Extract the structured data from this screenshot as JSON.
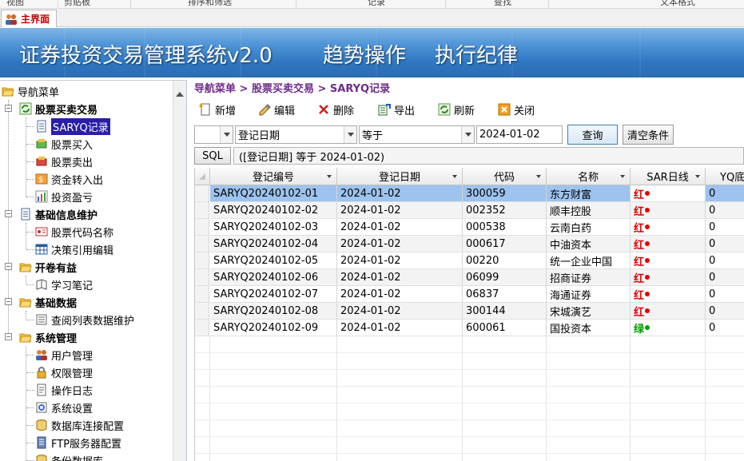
{
  "ribbon": {
    "groups": [
      "视图",
      "剪贴板",
      "排序和筛选",
      "记录",
      "查找",
      "文本格式"
    ]
  },
  "tab": {
    "label": "主界面"
  },
  "banner": {
    "title": "证券投资交易管理系统v2.0",
    "slogan1": "趋势操作",
    "slogan2": "执行纪律"
  },
  "nav": {
    "root": "导航菜单",
    "groups": [
      {
        "label": "股票买卖交易",
        "items": [
          "SARYQ记录",
          "股票买入",
          "股票卖出",
          "资金转入出",
          "投资盈亏"
        ]
      },
      {
        "label": "基础信息维护",
        "items": [
          "股票代码名称",
          "决策引用编辑"
        ]
      },
      {
        "label": "开卷有益",
        "items": [
          "学习笔记"
        ]
      },
      {
        "label": "基础数据",
        "items": [
          "查阅列表数据维护"
        ]
      },
      {
        "label": "系统管理",
        "items": [
          "用户管理",
          "权限管理",
          "操作日志",
          "系统设置",
          "数据库连接配置",
          "FTP服务器配置",
          "备份数据库"
        ]
      }
    ],
    "selected": "SARYQ记录"
  },
  "breadcrumb": "导航菜单 > 股票买卖交易 > SARYQ记录",
  "toolbar": {
    "add": "新增",
    "edit": "编辑",
    "delete": "删除",
    "export": "导出",
    "refresh": "刷新",
    "close": "关闭"
  },
  "filter": {
    "prefix": "",
    "field": "登记日期",
    "operator": "等于",
    "value": "2024-01-02",
    "query": "查询",
    "clear": "清空条件"
  },
  "sql": {
    "label": "SQL",
    "text": "([登记日期] 等于 2024-01-02)"
  },
  "grid": {
    "columns": [
      "登记编号",
      "登记日期",
      "代码",
      "名称",
      "SAR日线",
      "YQ底"
    ],
    "rows": [
      {
        "id": "SARYQ20240102-01",
        "date": "2024-01-02",
        "code": "300059",
        "name": "东方财富",
        "sar": "红",
        "yq": "0"
      },
      {
        "id": "SARYQ20240102-02",
        "date": "2024-01-02",
        "code": "002352",
        "name": "顺丰控股",
        "sar": "红",
        "yq": "0"
      },
      {
        "id": "SARYQ20240102-03",
        "date": "2024-01-02",
        "code": "000538",
        "name": "云南白药",
        "sar": "红",
        "yq": "0"
      },
      {
        "id": "SARYQ20240102-04",
        "date": "2024-01-02",
        "code": "000617",
        "name": "中油资本",
        "sar": "红",
        "yq": "0"
      },
      {
        "id": "SARYQ20240102-05",
        "date": "2024-01-02",
        "code": "00220",
        "name": "统一企业中国",
        "sar": "红",
        "yq": "0"
      },
      {
        "id": "SARYQ20240102-06",
        "date": "2024-01-02",
        "code": "06099",
        "name": "招商证券",
        "sar": "红",
        "yq": "0"
      },
      {
        "id": "SARYQ20240102-07",
        "date": "2024-01-02",
        "code": "06837",
        "name": "海通证券",
        "sar": "红",
        "yq": "0"
      },
      {
        "id": "SARYQ20240102-08",
        "date": "2024-01-02",
        "code": "300144",
        "name": "宋城演艺",
        "sar": "红",
        "yq": "0"
      },
      {
        "id": "SARYQ20240102-09",
        "date": "2024-01-02",
        "code": "600061",
        "name": "国投资本",
        "sar": "绿",
        "yq": "0"
      }
    ],
    "selected_row": 0
  },
  "colors": {
    "red": "#e00000",
    "green": "#00a000",
    "accent": "#2a1ea9",
    "crumb": "#6e2b8a"
  },
  "icons": [
    "user-group-icon",
    "refresh-icon",
    "folder-icon",
    "document-icon",
    "add-icon",
    "edit-icon",
    "delete-icon",
    "export-icon",
    "close-icon",
    "database-icon",
    "server-icon",
    "lock-icon",
    "gear-icon",
    "chart-icon",
    "shopping-cart-icon"
  ]
}
